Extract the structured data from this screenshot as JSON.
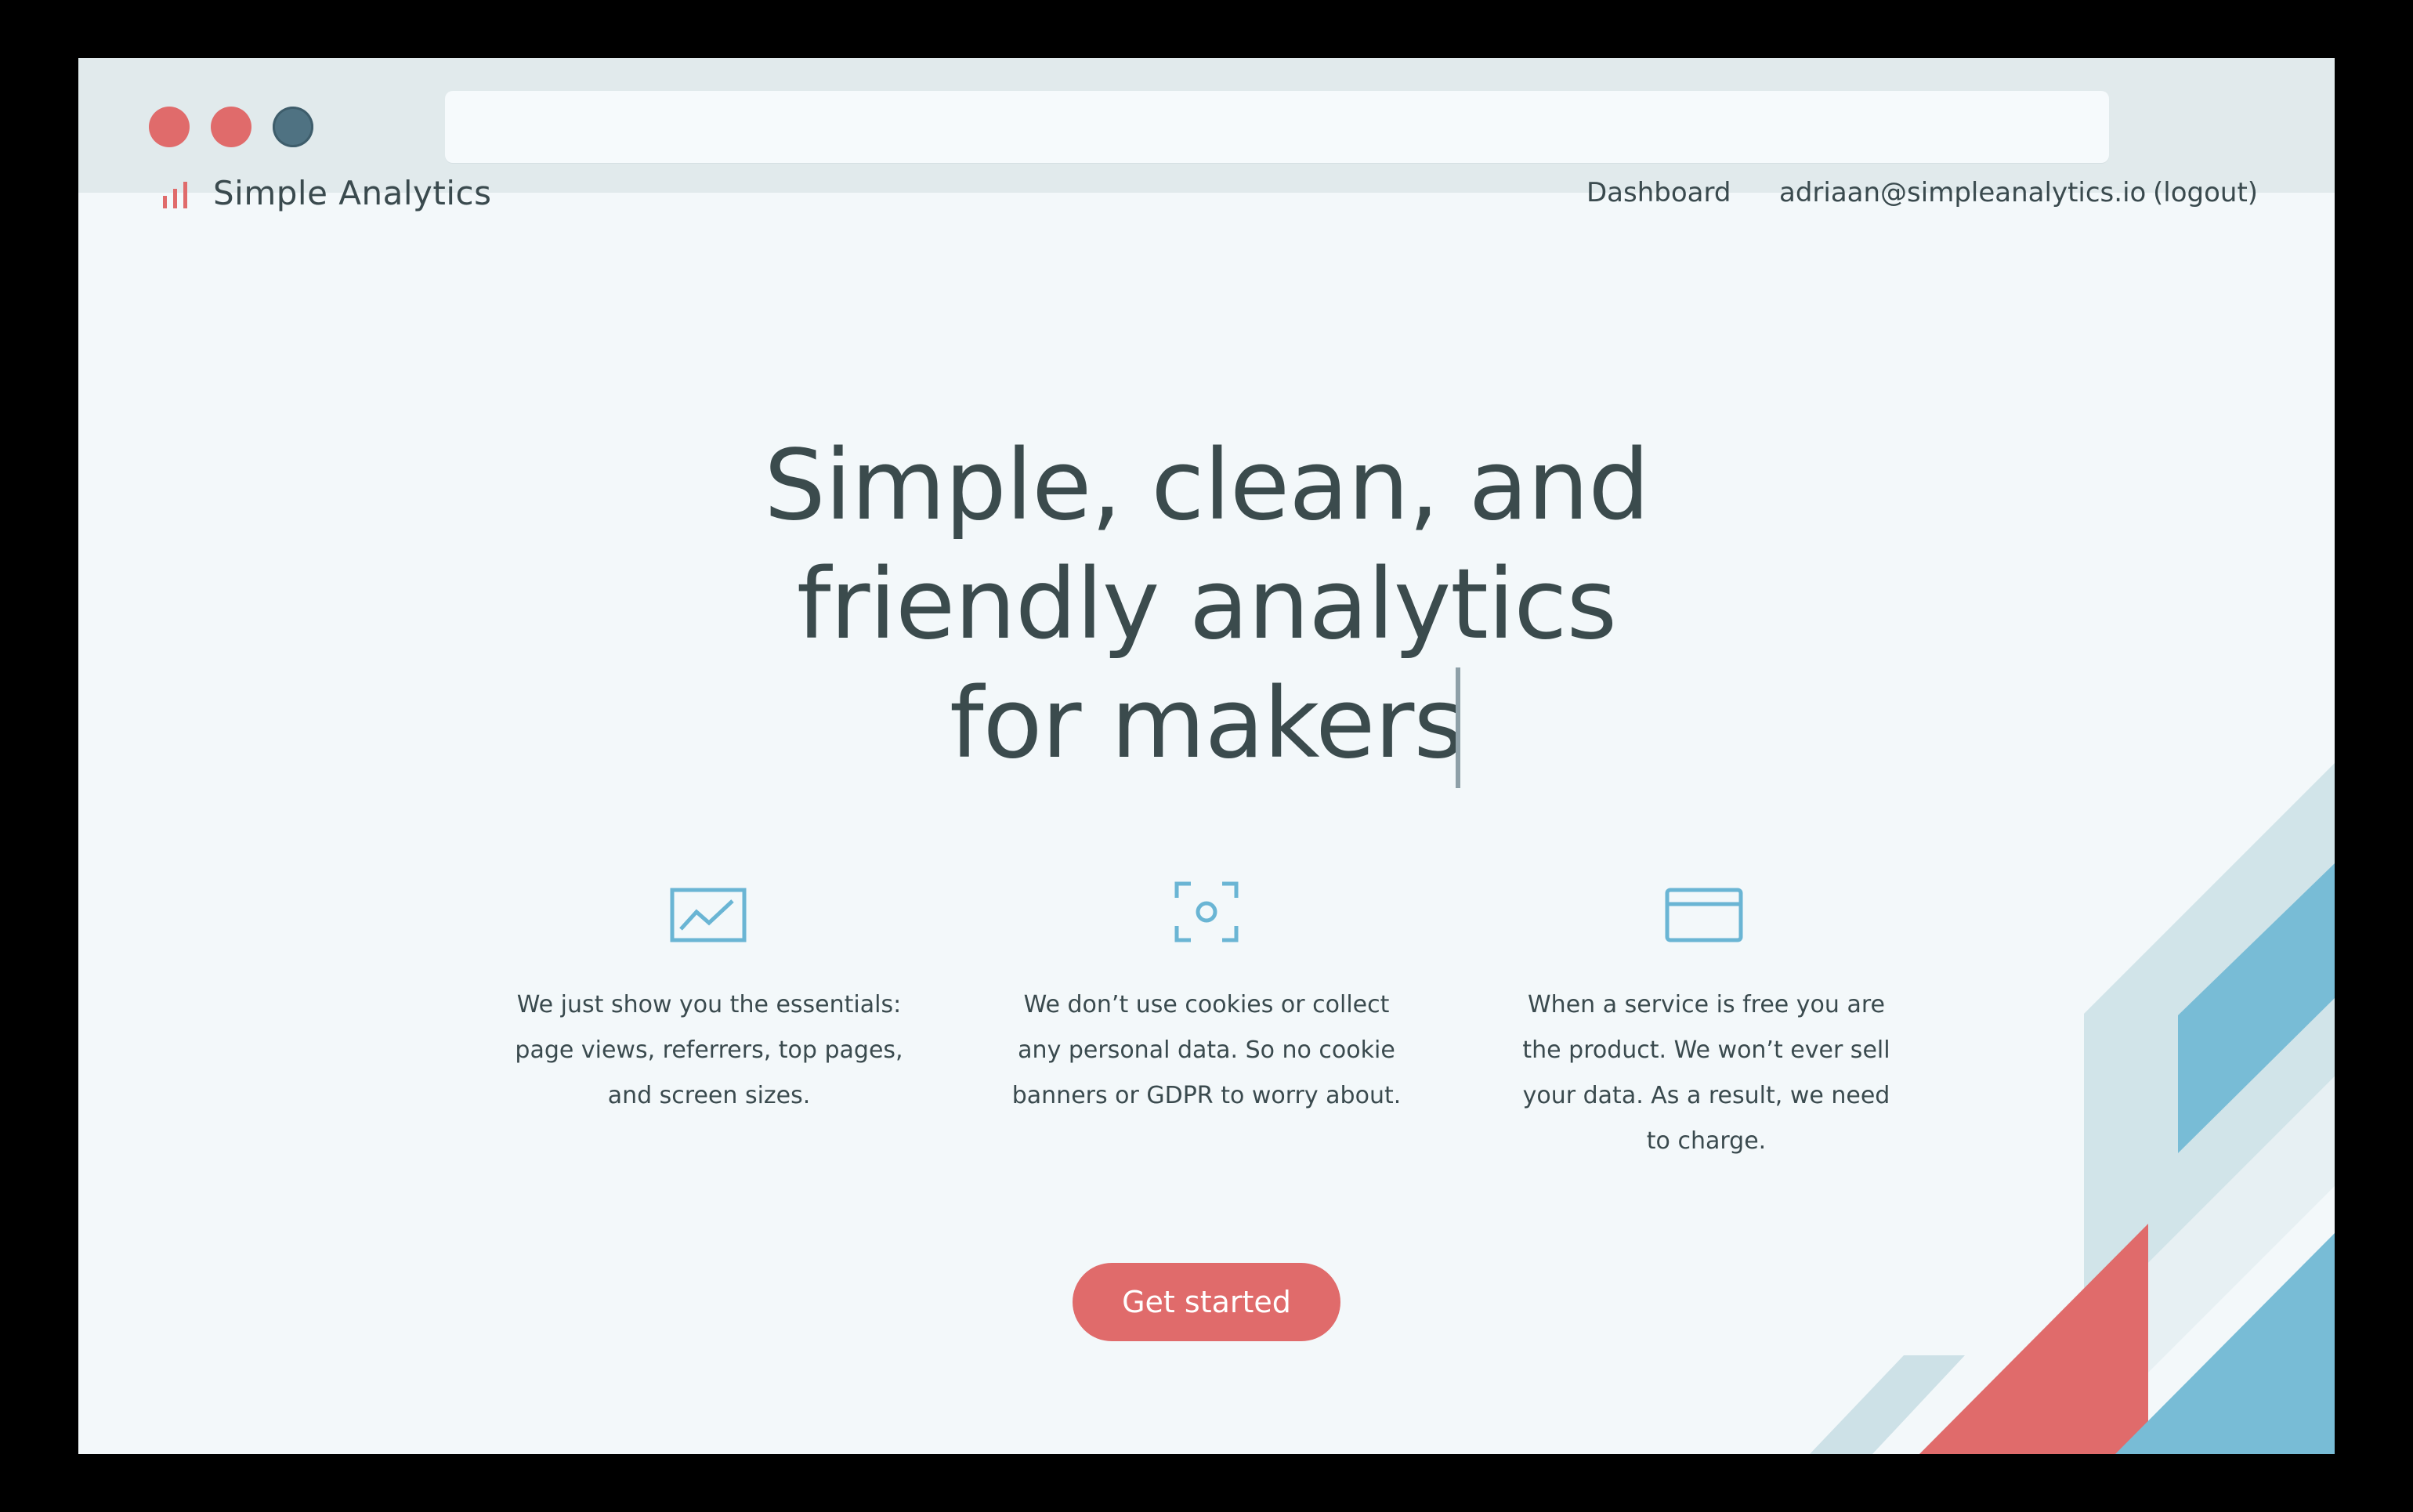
{
  "window": {
    "controls": [
      "close",
      "minimize",
      "maximize"
    ],
    "url": ""
  },
  "nav": {
    "brand_label": "Simple Analytics",
    "brand_icon": "bar-chart-icon",
    "dashboard_label": "Dashboard",
    "email_label": "adriaan@simpleanalytics.io",
    "logout_label": "(logout)"
  },
  "hero": {
    "line1": "Simple, clean, and",
    "line2": "friendly analytics",
    "line3": "for makers"
  },
  "features": [
    {
      "icon": "line-chart-icon",
      "lines": [
        "We just show you the essentials:",
        "page views, referrers, top pages,",
        "and screen sizes."
      ]
    },
    {
      "icon": "privacy-focus-icon",
      "lines": [
        "We don’t use cookies or collect",
        "any personal data. So no cookie",
        "banners or GDPR to worry about."
      ]
    },
    {
      "icon": "credit-card-icon",
      "lines": [
        "When a service is free you are",
        "the product. We won’t ever sell",
        "your data. As a result, we need",
        "to charge."
      ]
    }
  ],
  "cta": {
    "label": "Get started"
  },
  "colors": {
    "accent": "#e06b6b",
    "text": "#3b4b4d",
    "icon": "#6ab5d4",
    "background": "#f3f8fa",
    "chrome": "#e1eaec",
    "deco_blue": "#78bcd6",
    "deco_light": "#cde1e7"
  }
}
